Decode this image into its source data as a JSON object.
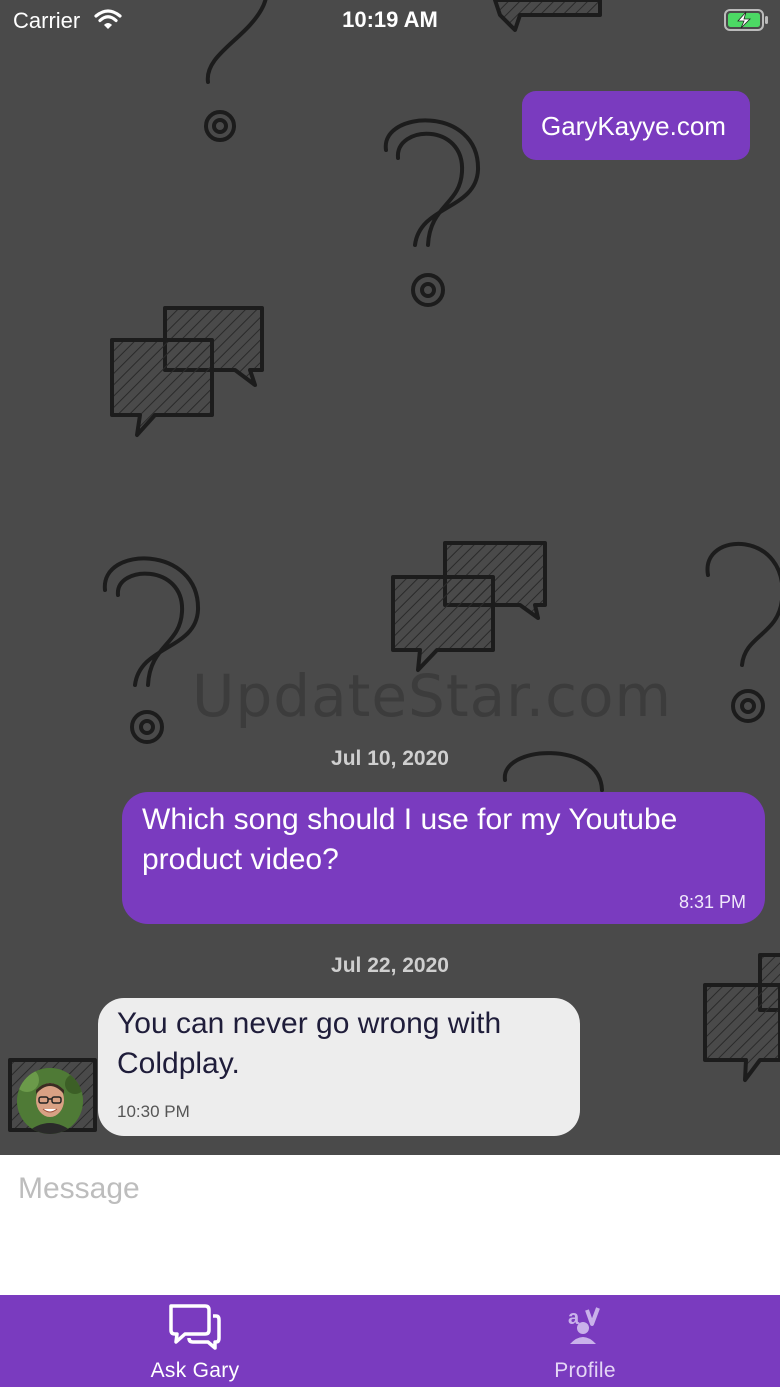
{
  "status_bar": {
    "carrier": "Carrier",
    "time": "10:19 AM"
  },
  "background": {
    "watermark": "UpdateStar.com"
  },
  "chat": {
    "link_message": "GaryKayye.com",
    "groups": [
      {
        "date": "Jul 10, 2020",
        "message": "Which song should I use for my Youtube product video?",
        "time": "8:31 PM",
        "direction": "outgoing"
      },
      {
        "date": "Jul 22, 2020",
        "message": "You can never go wrong with Coldplay.",
        "time": "10:30 PM",
        "direction": "incoming"
      }
    ]
  },
  "composer": {
    "placeholder": "Message",
    "value": ""
  },
  "tab_bar": {
    "tabs": [
      {
        "label": "Ask Gary",
        "icon": "chat-bubbles-icon",
        "active": true
      },
      {
        "label": "Profile",
        "icon": "profile-icon",
        "active": false
      }
    ]
  },
  "colors": {
    "accent": "#7a3bbf",
    "background": "#4a4a4a",
    "incoming_bubble": "#ededed",
    "battery_charge": "#4cd964"
  }
}
